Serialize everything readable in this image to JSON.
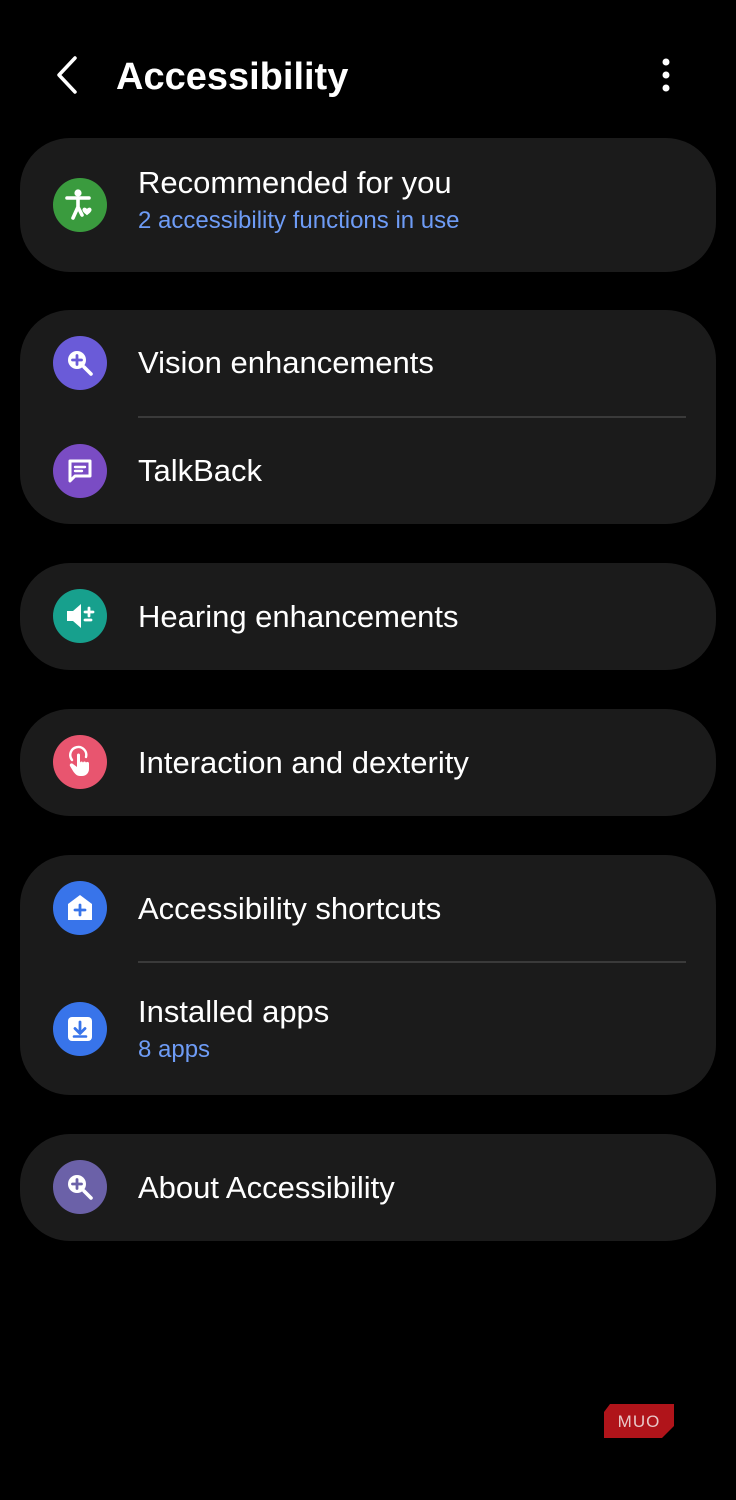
{
  "header": {
    "title": "Accessibility",
    "back_icon": "chevron-left-icon",
    "more_icon": "more-vertical-icon"
  },
  "colors": {
    "background": "#000000",
    "card": "#1b1b1b",
    "subtitle_link": "#6e9cf6",
    "divider": "#3a3a3a"
  },
  "items": {
    "recommended": {
      "title": "Recommended for you",
      "subtitle": "2 accessibility functions in use",
      "icon": "accessibility-person-icon",
      "icon_color": "#3a9b3e"
    },
    "vision": {
      "title": "Vision enhancements",
      "icon": "zoom-in-icon",
      "icon_color": "#6a5bd8"
    },
    "talkback": {
      "title": "TalkBack",
      "icon": "chat-bubble-icon",
      "icon_color": "#7a4cc4"
    },
    "hearing": {
      "title": "Hearing enhancements",
      "icon": "speaker-plus-icon",
      "icon_color": "#17a08d"
    },
    "interaction": {
      "title": "Interaction and dexterity",
      "icon": "touch-hand-icon",
      "icon_color": "#e8556f"
    },
    "shortcuts": {
      "title": "Accessibility shortcuts",
      "icon": "home-plus-icon",
      "icon_color": "#3874ea"
    },
    "installed": {
      "title": "Installed apps",
      "subtitle": "8 apps",
      "icon": "download-icon",
      "icon_color": "#3874ea"
    },
    "about": {
      "title": "About Accessibility",
      "icon": "zoom-in-icon",
      "icon_color": "#6b61a8"
    }
  },
  "watermark": {
    "text": "MUO",
    "color": "#b0141a"
  }
}
